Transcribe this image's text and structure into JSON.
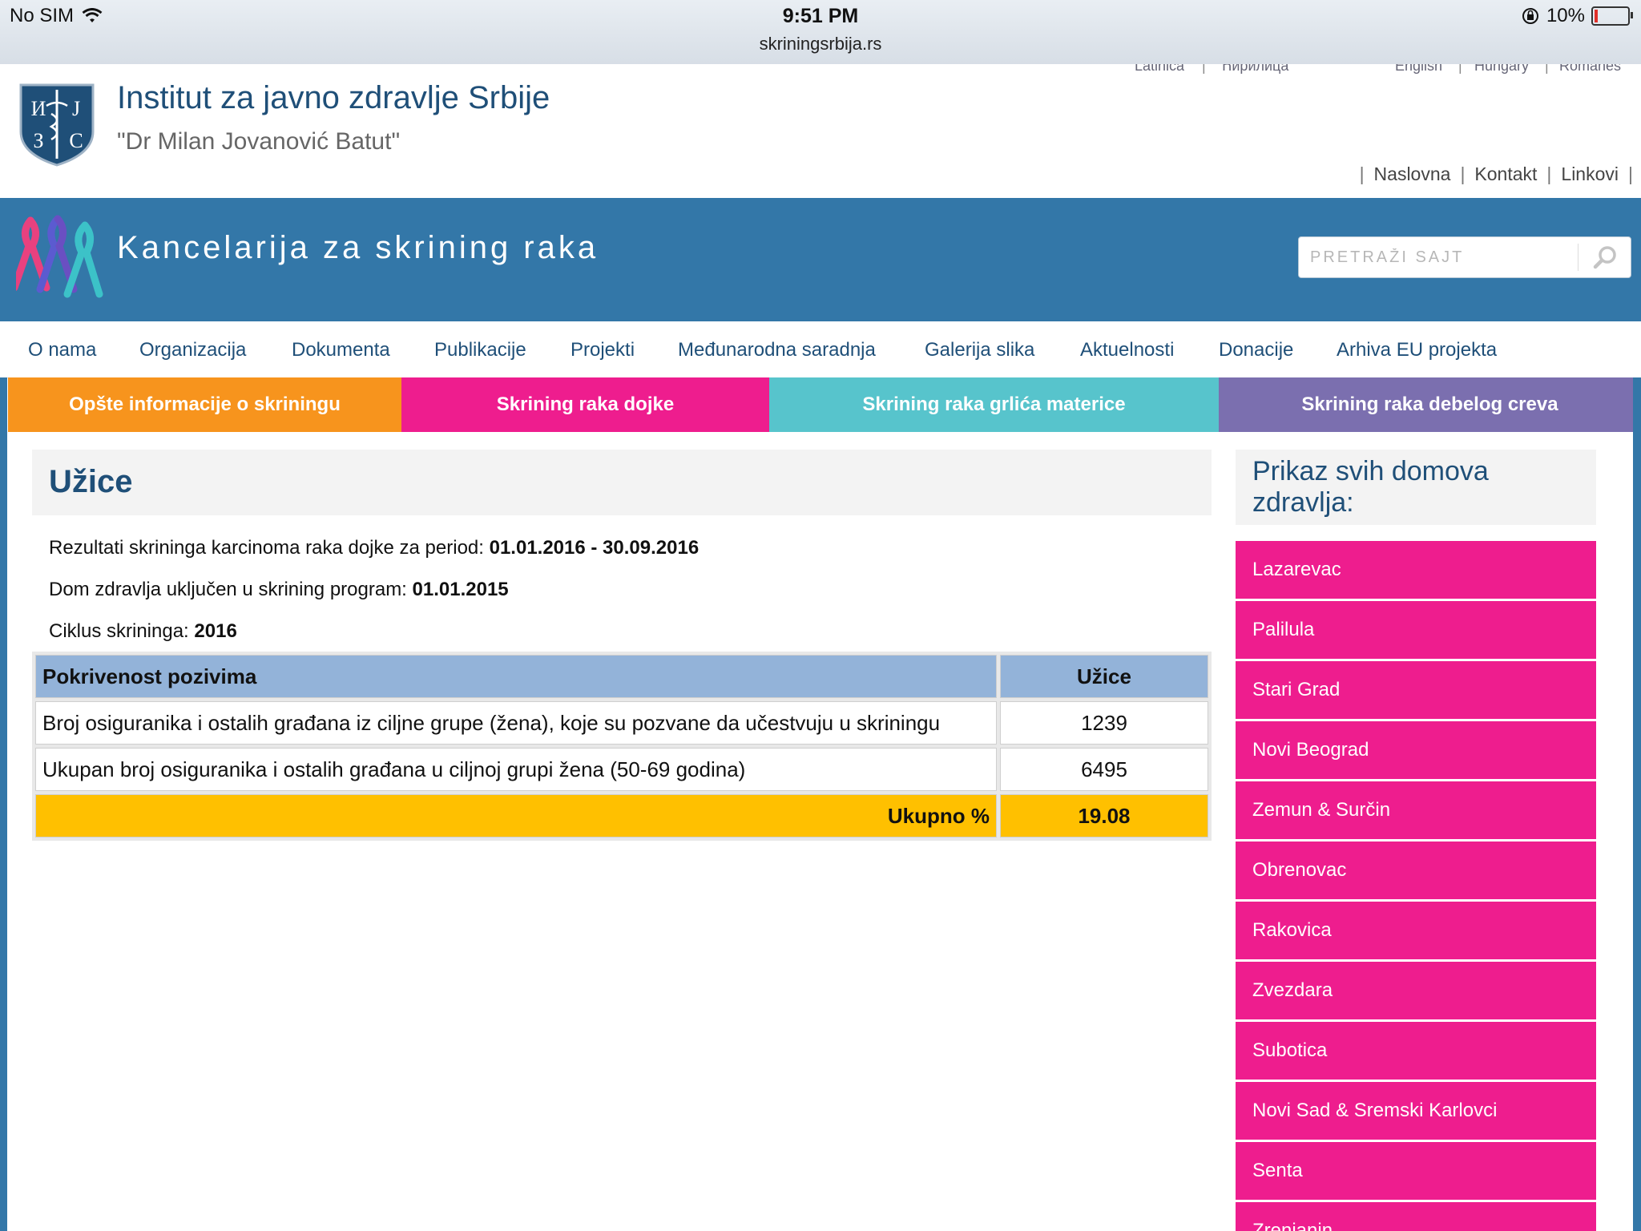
{
  "status_bar": {
    "carrier": "No SIM",
    "time": "9:51 PM",
    "url": "skriningsrbija.rs",
    "battery": "10%",
    "battery_level": 0.1,
    "battery_color": "#e0302a",
    "icons": [
      "wifi-icon",
      "orientation-lock-icon",
      "battery-icon"
    ]
  },
  "header": {
    "languages": [
      "Latinica",
      "Ћирилица",
      "English",
      "Hungary",
      "Romanes"
    ],
    "institute_title": "Institut za javno zdravlje Srbije",
    "institute_subtitle": "\"Dr Milan Jovanović Batut\"",
    "top_links": [
      "Naslovna",
      "Kontakt",
      "Linkovi"
    ]
  },
  "banner": {
    "title": "Kancelarija za skrining raka",
    "search_placeholder": "PRETRAŽI SAJT",
    "color": "#3377a8"
  },
  "nav": {
    "items": [
      "O nama",
      "Organizacija",
      "Dokumenta",
      "Publikacije",
      "Projekti",
      "Međunarodna saradnja",
      "Galerija slika",
      "Aktuelnosti",
      "Donacije",
      "Arhiva EU projekta"
    ]
  },
  "category_tabs": [
    {
      "label": "Opšte informacije o skriningu",
      "color": "#f7941d"
    },
    {
      "label": "Skrining raka dojke",
      "color": "#ee1d8e"
    },
    {
      "label": "Skrining raka grlića materice",
      "color": "#57c4cc"
    },
    {
      "label": "Skrining raka debelog creva",
      "color": "#7b6faf"
    }
  ],
  "main": {
    "title": "Užice",
    "period_label": "Rezultati skrininga karcinoma raka dojke za period:",
    "period_value": "01.01.2016 - 30.09.2016",
    "included_label": "Dom zdravlja uključen u skrining program:",
    "included_value": "01.01.2015",
    "cycle_label": "Ciklus skrininga:",
    "cycle_value": "2016",
    "table": {
      "header": [
        "Pokrivenost pozivima",
        "Užice"
      ],
      "rows": [
        [
          "Broj osiguranika i ostalih građana iz ciljne grupe (žena), koje su pozvane da učestvuju u skriningu",
          "1239"
        ],
        [
          "Ukupan broj osiguranika i ostalih građana u ciljnoj grupi žena (50-69 godina)",
          "6495"
        ]
      ],
      "total_label": "Ukupno %",
      "total_value": "19.08"
    }
  },
  "sidebar": {
    "heading": "Prikaz svih domova zdravlja:",
    "items": [
      "Lazarevac",
      "Palilula",
      "Stari Grad",
      "Novi Beograd",
      "Zemun & Surčin",
      "Obrenovac",
      "Rakovica",
      "Zvezdara",
      "Subotica",
      "Novi Sad & Sremski Karlovci",
      "Senta",
      "Zrenjanin"
    ],
    "item_color": "#ee1d8e"
  }
}
